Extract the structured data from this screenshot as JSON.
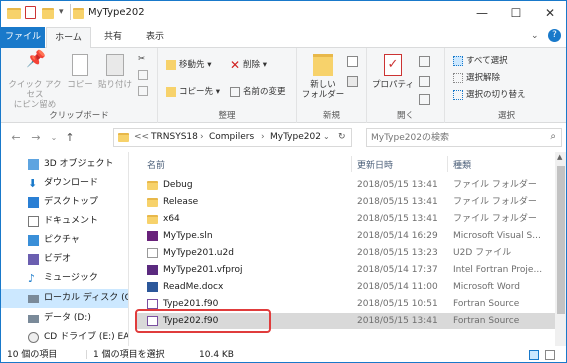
{
  "window": {
    "title": "MyType202",
    "minimize": "—",
    "maximize": "☐",
    "close": "✕"
  },
  "ribbon_tabs": {
    "file": "ファイル",
    "home": "ホーム",
    "share": "共有",
    "view": "表示"
  },
  "ribbon": {
    "clipboard": {
      "label": "クリップボード",
      "pin": "クイック アクセス\nにピン留め",
      "copy": "コピー",
      "paste": "貼り付け"
    },
    "organize": {
      "label": "整理",
      "move_to": "移動先",
      "copy_to": "コピー先",
      "delete": "削除",
      "rename": "名前の変更"
    },
    "new": {
      "label": "新規",
      "new_folder": "新しい\nフォルダー"
    },
    "open": {
      "label": "開く",
      "properties": "プロパティ"
    },
    "select": {
      "label": "選択",
      "select_all": "すべて選択",
      "select_none": "選択解除",
      "invert": "選択の切り替え"
    }
  },
  "address": {
    "crumb_prefix": "<<",
    "crumbs": [
      "TRNSYS18",
      "Compilers",
      "MyType202"
    ],
    "search_placeholder": "MyType202の検索"
  },
  "nav_pane": [
    {
      "label": "3D オブジェクト",
      "icon": "cube-icon"
    },
    {
      "label": "ダウンロード",
      "icon": "download-icon"
    },
    {
      "label": "デスクトップ",
      "icon": "desktop-icon"
    },
    {
      "label": "ドキュメント",
      "icon": "document-icon"
    },
    {
      "label": "ピクチャ",
      "icon": "picture-icon"
    },
    {
      "label": "ビデオ",
      "icon": "video-icon"
    },
    {
      "label": "ミュージック",
      "icon": "music-icon"
    },
    {
      "label": "ローカル ディスク (C",
      "icon": "drive-icon",
      "selected": true
    },
    {
      "label": "データ (D:)",
      "icon": "drive-icon"
    },
    {
      "label": "CD ドライブ (E:) EA",
      "icon": "cd-drive-icon"
    }
  ],
  "columns": {
    "name": "名前",
    "date": "更新日時",
    "type": "種類"
  },
  "files": [
    {
      "name": "Debug",
      "date": "2018/05/15 13:41",
      "type": "ファイル フォルダー",
      "icon": "folder-icon"
    },
    {
      "name": "Release",
      "date": "2018/05/15 13:41",
      "type": "ファイル フォルダー",
      "icon": "folder-icon"
    },
    {
      "name": "x64",
      "date": "2018/05/15 13:41",
      "type": "ファイル フォルダー",
      "icon": "folder-icon"
    },
    {
      "name": "MyType.sln",
      "date": "2018/05/14 16:29",
      "type": "Microsoft Visual S...",
      "icon": "solution-icon"
    },
    {
      "name": "MyType201.u2d",
      "date": "2018/05/15 13:23",
      "type": "U2D ファイル",
      "icon": "file-icon"
    },
    {
      "name": "MyType201.vfproj",
      "date": "2018/05/14 17:37",
      "type": "Intel Fortran Proje...",
      "icon": "fortran-project-icon"
    },
    {
      "name": "ReadMe.docx",
      "date": "2018/05/14 11:00",
      "type": "Microsoft Word",
      "icon": "word-doc-icon"
    },
    {
      "name": "Type201.f90",
      "date": "2018/05/15 10:51",
      "type": "Fortran Source",
      "icon": "fortran-source-icon"
    },
    {
      "name": "Type202.f90",
      "date": "2018/05/15 13:41",
      "type": "Fortran Source",
      "icon": "fortran-source-icon",
      "selected": true
    }
  ],
  "status": {
    "count": "10 個の項目",
    "selected": "1 個の項目を選択",
    "size": "10.4 KB"
  },
  "colors": {
    "accent": "#1979ca",
    "highlight": "#e03c3c",
    "folder": "#f7d26b"
  }
}
